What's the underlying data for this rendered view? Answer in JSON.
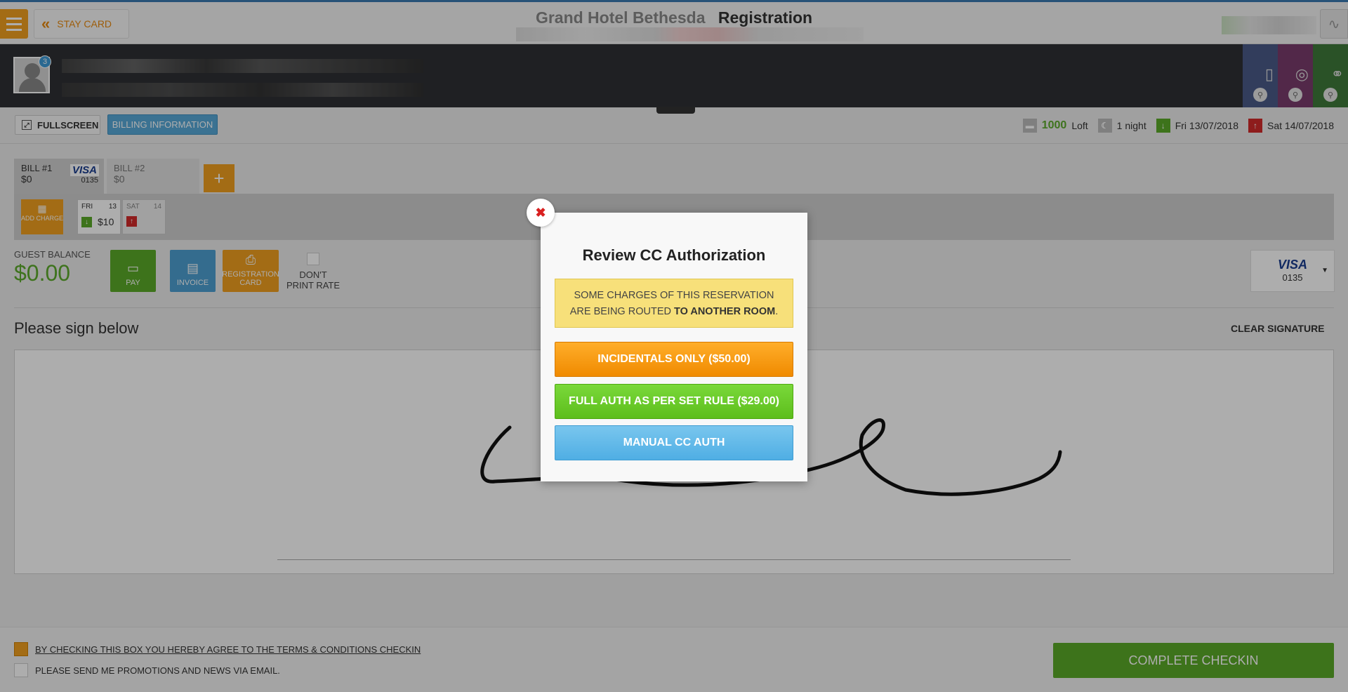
{
  "header": {
    "hotel_name": "Grand Hotel Bethesda",
    "page_title": "Registration",
    "back_label": "STAY CARD"
  },
  "guest": {
    "badge_count": "3"
  },
  "toolbar": {
    "fullscreen_label": "FULLSCREEN",
    "billing_info_label": "BILLING INFORMATION"
  },
  "stay": {
    "room_number": "1000",
    "room_type": "Loft",
    "nights": "1 night",
    "arrival": "Fri 13/07/2018",
    "departure": "Sat 14/07/2018"
  },
  "bills": [
    {
      "label": "BILL #1",
      "amount": "$0",
      "card_logo": "VISA",
      "card_last4": "0135"
    },
    {
      "label": "BILL #2",
      "amount": "$0"
    }
  ],
  "add_bill_label": "+",
  "add_charge_label": "ADD CHARGE",
  "days": [
    {
      "day": "FRI",
      "date": "13",
      "amount": "$10"
    },
    {
      "day": "SAT",
      "date": "14",
      "amount": ""
    }
  ],
  "balance": {
    "label": "GUEST BALANCE",
    "value": "$0.00"
  },
  "actions": {
    "pay": "PAY",
    "invoice": "INVOICE",
    "registration_card": "REGISTRATION CARD",
    "dont_print_rate": "DON'T PRINT RATE"
  },
  "payment_card": {
    "logo": "VISA",
    "last4": "0135"
  },
  "signature": {
    "prompt": "Please sign below",
    "clear_label": "CLEAR SIGNATURE"
  },
  "footer": {
    "terms_text": "BY CHECKING THIS BOX YOU HEREBY AGREE TO THE TERMS & CONDITIONS CHECKIN",
    "promo_text": "PLEASE SEND ME PROMOTIONS AND NEWS VIA EMAIL.",
    "complete_label": "COMPLETE CHECKIN"
  },
  "modal": {
    "title": "Review CC Authorization",
    "warning_prefix": "SOME CHARGES OF THIS RESERVATION ARE BEING ROUTED ",
    "warning_bold": "TO ANOTHER ROOM",
    "warning_suffix": ".",
    "incidentals_label": "INCIDENTALS ONLY ($50.00)",
    "full_auth_label": "FULL AUTH AS PER SET RULE ($29.00)",
    "manual_label": "MANUAL CC AUTH"
  },
  "colors": {
    "accent_orange": "#f0a020",
    "accent_green": "#5aaa28",
    "accent_blue": "#58a9d8",
    "modal_orange": "#f08a00",
    "modal_green": "#5dbe1c",
    "modal_blue": "#4faee4",
    "warning_yellow": "#f7e07a"
  }
}
